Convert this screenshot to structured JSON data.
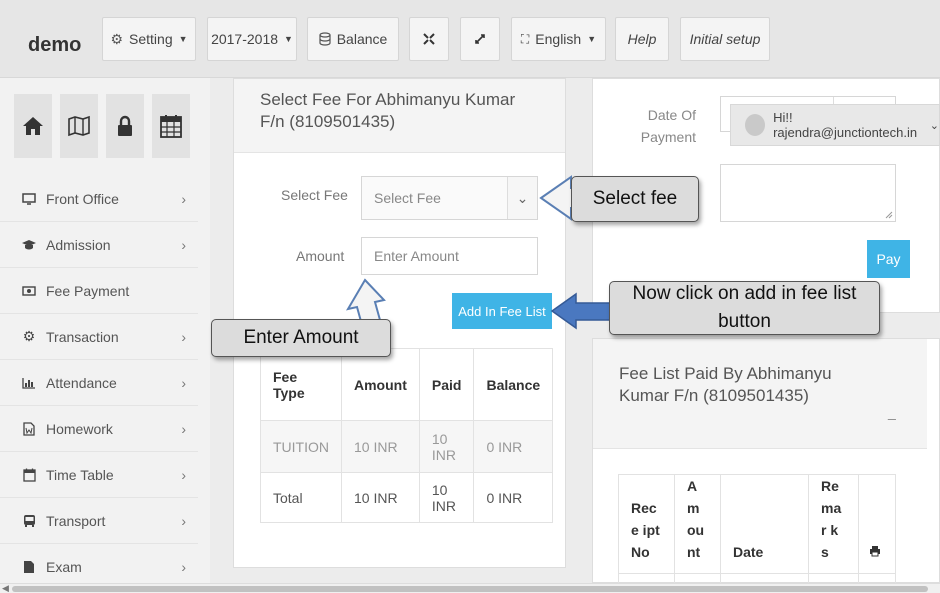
{
  "topbar": {
    "brand": "demo",
    "setting_label": "Setting",
    "session_label": "2017-2018",
    "balance_label": "Balance",
    "language_label": "English",
    "help_label": "Help",
    "initial_setup_label": "Initial setup"
  },
  "sidebar": {
    "items": [
      {
        "label": "Front Office"
      },
      {
        "label": "Admission"
      },
      {
        "label": "Fee Payment"
      },
      {
        "label": "Transaction"
      },
      {
        "label": "Attendance"
      },
      {
        "label": "Homework"
      },
      {
        "label": "Time Table"
      },
      {
        "label": "Transport"
      },
      {
        "label": "Exam"
      }
    ]
  },
  "fee_panel": {
    "title": "Select Fee For Abhimanyu Kumar F/n  (8109501435)",
    "select_fee_label": "Select Fee",
    "select_fee_value": "Select Fee",
    "amount_label": "Amount",
    "amount_placeholder": "Enter Amount",
    "add_button": "Add In Fee List",
    "table": {
      "headers": [
        "Fee Type",
        "Amount",
        "Paid",
        "Balance"
      ],
      "rows": [
        [
          "TUITION",
          "10 INR",
          "10 INR",
          "0 INR"
        ],
        [
          "Total",
          "10 INR",
          "10 INR",
          "0 INR"
        ]
      ]
    }
  },
  "payment_panel": {
    "date_label": "Date Of Payment",
    "pay_button": "Pay"
  },
  "user": {
    "greeting": "Hi!! rajendra@junctiontech.in"
  },
  "paid_panel": {
    "title": "Fee List Paid By Abhimanyu Kumar F/n  (8109501435)",
    "minimize": "_",
    "headers": [
      "Rece ipt No",
      "Am ou nt",
      "Date",
      "Re mar ks"
    ]
  },
  "callouts": {
    "select_fee": "Select fee",
    "enter_amount": "Enter Amount",
    "add_list": "Now click on add in fee list button"
  }
}
